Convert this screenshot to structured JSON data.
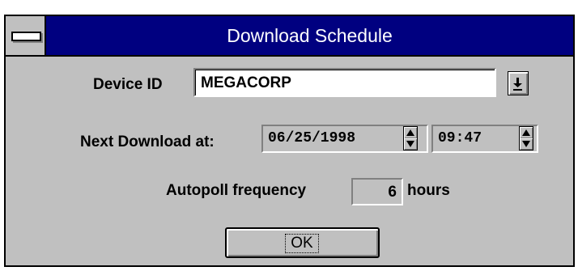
{
  "window": {
    "title": "Download Schedule"
  },
  "device": {
    "label": "Device ID",
    "value": "MEGACORP"
  },
  "next_download": {
    "label": "Next Download at:",
    "date": "06/25/1998",
    "time": "09:47"
  },
  "autopoll": {
    "label": "Autopoll frequency",
    "value": "6",
    "unit": "hours"
  },
  "buttons": {
    "ok_label": "OK"
  },
  "icons": {
    "system_menu": "system-menu-icon",
    "dropdown": "down-arrow-icon",
    "spinner": "spinner-icon"
  },
  "colors": {
    "titlebar": "#000080",
    "dialog_face": "#c0c0c0",
    "title_text": "#ffffff"
  }
}
